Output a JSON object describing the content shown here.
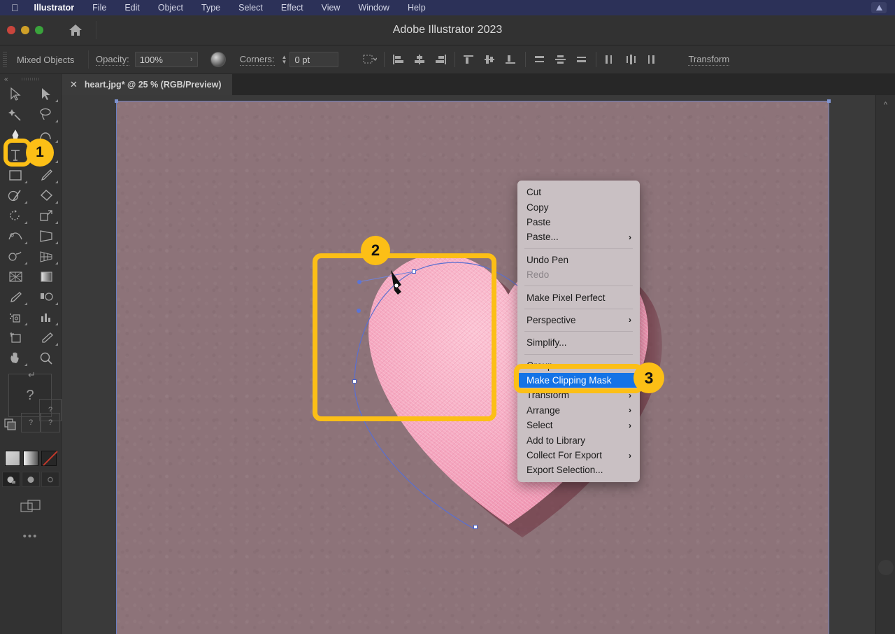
{
  "menubar": {
    "apple_icon": "apple-logo",
    "app_name": "Illustrator",
    "items": [
      "File",
      "Edit",
      "Object",
      "Type",
      "Select",
      "Effect",
      "View",
      "Window",
      "Help"
    ],
    "status_icon": "control-center-icon"
  },
  "titlebar": {
    "title": "Adobe Illustrator 2023",
    "home_icon": "home-icon",
    "close_label": "close",
    "minimize_label": "minimize",
    "zoom_label": "zoom"
  },
  "controlbar": {
    "selection_label": "Mixed Objects",
    "opacity_label": "Opacity:",
    "opacity_value": "100%",
    "opacity_chevron": "chevron-right-icon",
    "opacity_mask_icon": "opacity-mask-icon",
    "corners_label": "Corners:",
    "corners_value": "0 pt",
    "corners_stepper_icon": "stepper-icon",
    "distribute_spacing_icon": "distribute-spacing-icon",
    "align_buttons": [
      "align-left-icon",
      "align-horizontal-center-icon",
      "align-right-icon",
      "align-top-icon",
      "align-vertical-center-icon",
      "align-bottom-icon",
      "distribute-top-icon",
      "distribute-vertical-center-icon",
      "distribute-bottom-icon",
      "distribute-left-icon",
      "distribute-horizontal-center-icon",
      "distribute-right-icon"
    ],
    "transform_label": "Transform"
  },
  "tabbar": {
    "close_icon": "close-icon",
    "document_title": "heart.jpg* @ 25 % (RGB/Preview)"
  },
  "toolbar": {
    "collapse_icon": "collapse-panel-icon",
    "grip_icon": "drag-grip-icon",
    "tools": [
      "selection-tool-icon",
      "direct-selection-tool-icon",
      "magic-wand-tool-icon",
      "lasso-tool-icon",
      "pen-tool-icon",
      "curvature-tool-icon",
      "type-tool-icon",
      "line-segment-tool-icon",
      "rectangle-tool-icon",
      "paintbrush-tool-icon",
      "shaper-tool-icon",
      "eraser-tool-icon",
      "rotate-tool-icon",
      "scale-tool-icon",
      "width-tool-icon",
      "free-transform-tool-icon",
      "shape-builder-tool-icon",
      "perspective-grid-tool-icon",
      "mesh-tool-icon",
      "gradient-tool-icon",
      "eyedropper-tool-icon",
      "blend-tool-icon",
      "symbol-sprayer-tool-icon",
      "column-graph-tool-icon",
      "artboard-tool-icon",
      "slice-tool-icon",
      "hand-tool-icon",
      "zoom-tool-icon"
    ],
    "question_marks": [
      "?",
      "?",
      "?",
      "?"
    ],
    "edit_toolbar_icon": "edit-toolbar-icon",
    "swatches": [
      "fill-swatch",
      "gradient-swatch",
      "none-swatch"
    ],
    "draw_modes": [
      "draw-normal-icon",
      "draw-behind-icon",
      "draw-inside-icon"
    ],
    "screen_mode_icon": "screen-mode-icon",
    "more_icon": "more-options-icon"
  },
  "canvas": {
    "artboard_name": "artboard",
    "photo_name": "heart-photo",
    "pen_cursor_icon": "pen-cursor-icon"
  },
  "context_menu": {
    "items": [
      {
        "label": "Cut",
        "type": "item"
      },
      {
        "label": "Copy",
        "type": "item"
      },
      {
        "label": "Paste",
        "type": "item"
      },
      {
        "label": "Paste...",
        "type": "submenu"
      },
      {
        "label": "",
        "type": "separator"
      },
      {
        "label": "Undo Pen",
        "type": "item"
      },
      {
        "label": "Redo",
        "type": "disabled"
      },
      {
        "label": "",
        "type": "separator"
      },
      {
        "label": "Make Pixel Perfect",
        "type": "item"
      },
      {
        "label": "",
        "type": "separator"
      },
      {
        "label": "Perspective",
        "type": "submenu"
      },
      {
        "label": "",
        "type": "separator"
      },
      {
        "label": "Simplify...",
        "type": "item"
      },
      {
        "label": "",
        "type": "separator"
      },
      {
        "label": "Group",
        "type": "item"
      },
      {
        "label": "Make Clipping Mask",
        "type": "highlighted"
      },
      {
        "label": "Transform",
        "type": "submenu"
      },
      {
        "label": "Arrange",
        "type": "submenu"
      },
      {
        "label": "Select",
        "type": "submenu"
      },
      {
        "label": "Add to Library",
        "type": "item"
      },
      {
        "label": "Collect For Export",
        "type": "submenu"
      },
      {
        "label": "Export Selection...",
        "type": "item"
      }
    ],
    "submenu_arrow": "chevron-right-icon"
  },
  "annotations": [
    {
      "number": "1",
      "target": "pen-tool"
    },
    {
      "number": "2",
      "target": "clipping-path-region"
    },
    {
      "number": "3",
      "target": "make-clipping-mask-menu-item"
    }
  ],
  "right_panel": {
    "expand_icon": "chevron-up-icon"
  },
  "colors": {
    "menubar_bg": "#2c3158",
    "chrome_bg": "#323232",
    "canvas_bg": "#3a3a3a",
    "artboard_bg": "#8d7379",
    "heart_pink": "#f5a6bf",
    "accent_yellow": "#fcbf16",
    "highlight_blue": "#1473e6",
    "menu_bg": "#c9c0c3",
    "selection_outline": "#6a7fc0"
  }
}
